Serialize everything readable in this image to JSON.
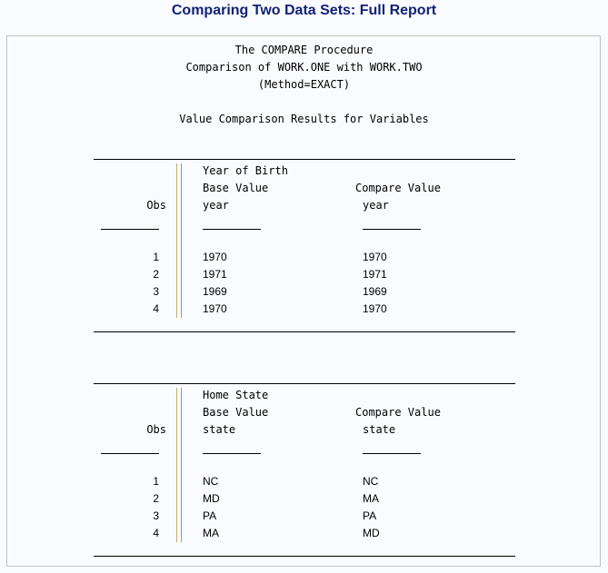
{
  "page_title": "Comparing Two Data Sets: Full Report",
  "header": {
    "procedure": "The COMPARE Procedure",
    "comparison": "Comparison of WORK.ONE with WORK.TWO",
    "method": "(Method=EXACT)",
    "section_title": "Value Comparison Results for Variables"
  },
  "tables": [
    {
      "variable_label": "Year of Birth",
      "base_header": "Base Value",
      "compare_header": "Compare Value",
      "obs_header": "Obs",
      "base_var": "year",
      "compare_var": "year",
      "rows": [
        {
          "obs": "1",
          "base": "1970",
          "compare": "1970"
        },
        {
          "obs": "2",
          "base": "1971",
          "compare": "1971"
        },
        {
          "obs": "3",
          "base": "1969",
          "compare": "1969"
        },
        {
          "obs": "4",
          "base": "1970",
          "compare": "1970"
        }
      ]
    },
    {
      "variable_label": "Home State",
      "base_header": "Base Value",
      "compare_header": "Compare Value",
      "obs_header": "Obs",
      "base_var": "state",
      "compare_var": "state",
      "rows": [
        {
          "obs": "1",
          "base": "NC",
          "compare": "NC"
        },
        {
          "obs": "2",
          "base": "MD",
          "compare": "MA"
        },
        {
          "obs": "3",
          "base": "PA",
          "compare": "PA"
        },
        {
          "obs": "4",
          "base": "MA",
          "compare": "MD"
        }
      ]
    }
  ]
}
